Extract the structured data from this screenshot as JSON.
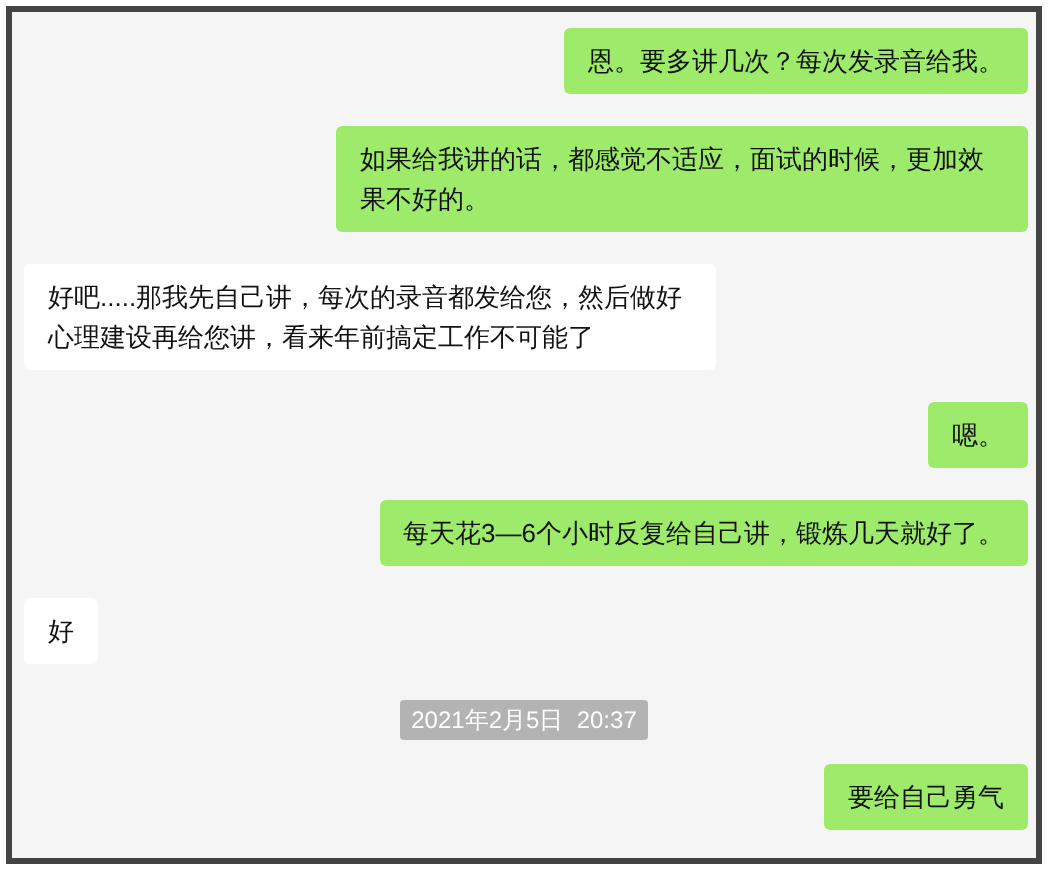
{
  "messages": [
    {
      "kind": "sent",
      "text": "恩。要多讲几次？每次发录音给我。"
    },
    {
      "kind": "sent",
      "text": "如果给我讲的话，都感觉不适应，面试的时候，更加效果不好的。"
    },
    {
      "kind": "received",
      "text": "好吧.....那我先自己讲，每次的录音都发给您，然后做好心理建设再给您讲，看来年前搞定工作不可能了"
    },
    {
      "kind": "sent",
      "text": "嗯。"
    },
    {
      "kind": "sent",
      "text": "每天花3—6个小时反复给自己讲，锻炼几天就好了。"
    },
    {
      "kind": "received",
      "text": "好"
    },
    {
      "kind": "timestamp",
      "text": "2021年2月5日  20:37"
    },
    {
      "kind": "sent",
      "text": "要给自己勇气"
    }
  ]
}
